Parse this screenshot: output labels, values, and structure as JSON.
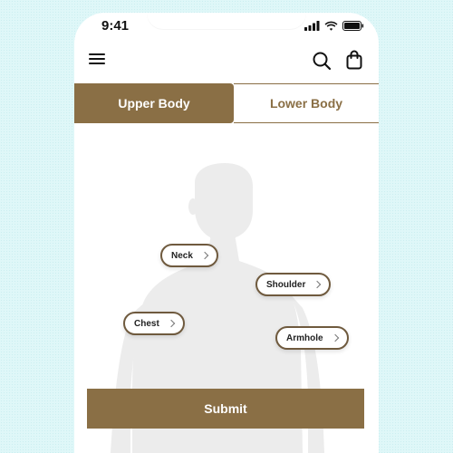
{
  "status_bar": {
    "time": "9:41",
    "icons": [
      "cellular-signal-icon",
      "wifi-icon",
      "battery-icon"
    ]
  },
  "nav": {
    "icons": [
      "menu-icon",
      "search-icon",
      "shopping-bag-icon"
    ]
  },
  "tabs": [
    {
      "label": "Upper Body",
      "active": true
    },
    {
      "label": "Lower Body",
      "active": false
    }
  ],
  "hotspots": {
    "neck": "Neck",
    "shoulder": "Shoulder",
    "chest": "Chest",
    "armhole": "Armhole"
  },
  "submit_label": "Submit",
  "colors": {
    "accent": "#8a6f45",
    "hotspot_border": "#6f5a3e",
    "silhouette": "#ececec",
    "page_background": "#dff7f8"
  }
}
